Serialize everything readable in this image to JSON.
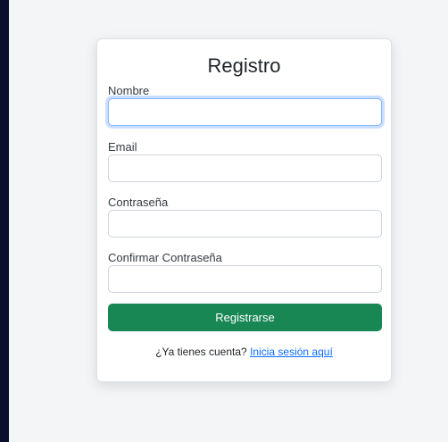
{
  "form": {
    "title": "Registro",
    "fields": {
      "nombre": {
        "label": "Nombre",
        "value": "",
        "placeholder": ""
      },
      "email": {
        "label": "Email",
        "value": "",
        "placeholder": ""
      },
      "password": {
        "label": "Contraseña",
        "value": "",
        "placeholder": ""
      },
      "confirm": {
        "label": "Confirmar Contraseña",
        "value": "",
        "placeholder": ""
      }
    },
    "submit_label": "Registrarse",
    "footer_text": "¿Ya tienes cuenta?",
    "login_link": "Inicia sesión aquí"
  },
  "colors": {
    "frame_background": "#0b0f2e",
    "page_background": "#f4f5f7",
    "submit_button": "#198754",
    "link": "#0d6efd",
    "focus_ring": "#86b7fe"
  }
}
